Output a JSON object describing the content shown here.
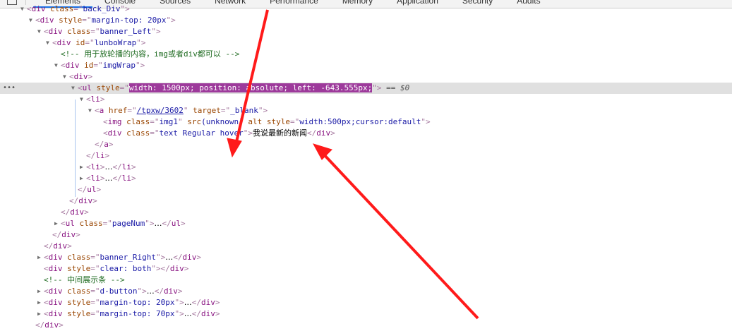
{
  "tabs": [
    "Elements",
    "Console",
    "Sources",
    "Network",
    "Performance",
    "Memory",
    "Application",
    "Security",
    "Audits"
  ],
  "active_tab": 0,
  "selected_row": 7,
  "selected_dots": "•••",
  "lines": [
    {
      "level": 0,
      "toggle": "open",
      "parts": [
        [
          "p",
          "<"
        ],
        [
          "t",
          "div"
        ],
        [
          "a",
          " class"
        ],
        [
          "p",
          "=\""
        ],
        [
          "v",
          "back_Div"
        ],
        [
          "p",
          "\">"
        ]
      ]
    },
    {
      "level": 1,
      "toggle": "open",
      "parts": [
        [
          "p",
          "<"
        ],
        [
          "t",
          "div"
        ],
        [
          "a",
          " style"
        ],
        [
          "p",
          "=\""
        ],
        [
          "v",
          "margin-top: 20px"
        ],
        [
          "p",
          "\">"
        ]
      ]
    },
    {
      "level": 2,
      "toggle": "open",
      "parts": [
        [
          "p",
          "<"
        ],
        [
          "t",
          "div"
        ],
        [
          "a",
          " class"
        ],
        [
          "p",
          "=\""
        ],
        [
          "v",
          "banner_Left"
        ],
        [
          "p",
          "\">"
        ]
      ]
    },
    {
      "level": 3,
      "toggle": "open",
      "parts": [
        [
          "p",
          "<"
        ],
        [
          "t",
          "div"
        ],
        [
          "a",
          " id"
        ],
        [
          "p",
          "=\""
        ],
        [
          "v",
          "lunboWrap"
        ],
        [
          "p",
          "\">"
        ]
      ]
    },
    {
      "level": 4,
      "toggle": "none",
      "parts": [
        [
          "c",
          "<!-- 用于放轮播的内容，img或者div都可以 -->"
        ]
      ]
    },
    {
      "level": 4,
      "toggle": "open",
      "parts": [
        [
          "p",
          "<"
        ],
        [
          "t",
          "div"
        ],
        [
          "a",
          " id"
        ],
        [
          "p",
          "=\""
        ],
        [
          "v",
          "imgWrap"
        ],
        [
          "p",
          "\">"
        ]
      ]
    },
    {
      "level": 5,
      "toggle": "open",
      "parts": [
        [
          "p",
          "<"
        ],
        [
          "t",
          "div"
        ],
        [
          "p",
          ">"
        ]
      ]
    },
    {
      "level": 6,
      "toggle": "open",
      "parts": [
        [
          "p",
          "<"
        ],
        [
          "t",
          "ul"
        ],
        [
          "a",
          " style"
        ],
        [
          "p",
          "=\""
        ],
        [
          "s",
          "width: 1500px; position: absolute; left: -643.555px;"
        ],
        [
          "p",
          "\">"
        ],
        [
          "m",
          " == $0"
        ]
      ]
    },
    {
      "level": 7,
      "toggle": "open",
      "parts": [
        [
          "p",
          "<"
        ],
        [
          "t",
          "li"
        ],
        [
          "p",
          ">"
        ]
      ]
    },
    {
      "level": 8,
      "toggle": "open",
      "parts": [
        [
          "p",
          "<"
        ],
        [
          "t",
          "a"
        ],
        [
          "a",
          " href"
        ],
        [
          "p",
          "=\""
        ],
        [
          "l",
          "/tpxw/3602"
        ],
        [
          "p",
          "\""
        ],
        [
          "a",
          " target"
        ],
        [
          "p",
          "=\""
        ],
        [
          "v",
          "_blank"
        ],
        [
          "p",
          "\">"
        ]
      ]
    },
    {
      "level": 9,
      "toggle": "none",
      "parts": [
        [
          "p",
          "<"
        ],
        [
          "t",
          "img"
        ],
        [
          "a",
          " class"
        ],
        [
          "p",
          "=\""
        ],
        [
          "v",
          "img1"
        ],
        [
          "p",
          "\""
        ],
        [
          "a",
          " src"
        ],
        [
          "v",
          "(unknown)"
        ],
        [
          "a",
          " alt style"
        ],
        [
          "p",
          "=\""
        ],
        [
          "v",
          "width:500px;cursor:default"
        ],
        [
          "p",
          "\">"
        ]
      ]
    },
    {
      "level": 9,
      "toggle": "none",
      "parts": [
        [
          "p",
          "<"
        ],
        [
          "t",
          "div"
        ],
        [
          "a",
          " class"
        ],
        [
          "p",
          "=\""
        ],
        [
          "v",
          "text Regular hover"
        ],
        [
          "p",
          "\">"
        ],
        [
          "x",
          "我说最新的新闻"
        ],
        [
          "p",
          "</"
        ],
        [
          "t",
          "div"
        ],
        [
          "p",
          ">"
        ]
      ]
    },
    {
      "level": 8,
      "toggle": "none",
      "parts": [
        [
          "p",
          "</"
        ],
        [
          "t",
          "a"
        ],
        [
          "p",
          ">"
        ]
      ]
    },
    {
      "level": 7,
      "toggle": "none",
      "parts": [
        [
          "p",
          "</"
        ],
        [
          "t",
          "li"
        ],
        [
          "p",
          ">"
        ]
      ]
    },
    {
      "level": 7,
      "toggle": "closed",
      "parts": [
        [
          "p",
          "<"
        ],
        [
          "t",
          "li"
        ],
        [
          "p",
          ">"
        ],
        [
          "x",
          "…"
        ],
        [
          "p",
          "</"
        ],
        [
          "t",
          "li"
        ],
        [
          "p",
          ">"
        ]
      ]
    },
    {
      "level": 7,
      "toggle": "closed",
      "parts": [
        [
          "p",
          "<"
        ],
        [
          "t",
          "li"
        ],
        [
          "p",
          ">"
        ],
        [
          "x",
          "…"
        ],
        [
          "p",
          "</"
        ],
        [
          "t",
          "li"
        ],
        [
          "p",
          ">"
        ]
      ]
    },
    {
      "level": 6,
      "toggle": "none",
      "parts": [
        [
          "p",
          "</"
        ],
        [
          "t",
          "ul"
        ],
        [
          "p",
          ">"
        ]
      ]
    },
    {
      "level": 5,
      "toggle": "none",
      "parts": [
        [
          "p",
          "</"
        ],
        [
          "t",
          "div"
        ],
        [
          "p",
          ">"
        ]
      ]
    },
    {
      "level": 4,
      "toggle": "none",
      "parts": [
        [
          "p",
          "</"
        ],
        [
          "t",
          "div"
        ],
        [
          "p",
          ">"
        ]
      ]
    },
    {
      "level": 4,
      "toggle": "closed",
      "parts": [
        [
          "p",
          "<"
        ],
        [
          "t",
          "ul"
        ],
        [
          "a",
          " class"
        ],
        [
          "p",
          "=\""
        ],
        [
          "v",
          "pageNum"
        ],
        [
          "p",
          "\">"
        ],
        [
          "x",
          "…"
        ],
        [
          "p",
          "</"
        ],
        [
          "t",
          "ul"
        ],
        [
          "p",
          ">"
        ]
      ]
    },
    {
      "level": 3,
      "toggle": "none",
      "parts": [
        [
          "p",
          "</"
        ],
        [
          "t",
          "div"
        ],
        [
          "p",
          ">"
        ]
      ]
    },
    {
      "level": 2,
      "toggle": "none",
      "parts": [
        [
          "p",
          "</"
        ],
        [
          "t",
          "div"
        ],
        [
          "p",
          ">"
        ]
      ]
    },
    {
      "level": 2,
      "toggle": "closed",
      "parts": [
        [
          "p",
          "<"
        ],
        [
          "t",
          "div"
        ],
        [
          "a",
          " class"
        ],
        [
          "p",
          "=\""
        ],
        [
          "v",
          "banner_Right"
        ],
        [
          "p",
          "\">"
        ],
        [
          "x",
          "…"
        ],
        [
          "p",
          "</"
        ],
        [
          "t",
          "div"
        ],
        [
          "p",
          ">"
        ]
      ]
    },
    {
      "level": 2,
      "toggle": "none",
      "parts": [
        [
          "p",
          "<"
        ],
        [
          "t",
          "div"
        ],
        [
          "a",
          " style"
        ],
        [
          "p",
          "=\""
        ],
        [
          "v",
          "clear: both"
        ],
        [
          "p",
          "\"></"
        ],
        [
          "t",
          "div"
        ],
        [
          "p",
          ">"
        ]
      ]
    },
    {
      "level": 2,
      "toggle": "none",
      "parts": [
        [
          "c",
          "<!-- 中间展示条 -->"
        ]
      ]
    },
    {
      "level": 2,
      "toggle": "closed",
      "parts": [
        [
          "p",
          "<"
        ],
        [
          "t",
          "div"
        ],
        [
          "a",
          " class"
        ],
        [
          "p",
          "=\""
        ],
        [
          "v",
          "d-button"
        ],
        [
          "p",
          "\">"
        ],
        [
          "x",
          "…"
        ],
        [
          "p",
          "</"
        ],
        [
          "t",
          "div"
        ],
        [
          "p",
          ">"
        ]
      ]
    },
    {
      "level": 2,
      "toggle": "closed",
      "parts": [
        [
          "p",
          "<"
        ],
        [
          "t",
          "div"
        ],
        [
          "a",
          " style"
        ],
        [
          "p",
          "=\""
        ],
        [
          "v",
          "margin-top: 20px"
        ],
        [
          "p",
          "\">"
        ],
        [
          "x",
          "…"
        ],
        [
          "p",
          "</"
        ],
        [
          "t",
          "div"
        ],
        [
          "p",
          ">"
        ]
      ]
    },
    {
      "level": 2,
      "toggle": "closed",
      "parts": [
        [
          "p",
          "<"
        ],
        [
          "t",
          "div"
        ],
        [
          "a",
          " style"
        ],
        [
          "p",
          "=\""
        ],
        [
          "v",
          "margin-top: 70px"
        ],
        [
          "p",
          "\">"
        ],
        [
          "x",
          "…"
        ],
        [
          "p",
          "</"
        ],
        [
          "t",
          "div"
        ],
        [
          "p",
          ">"
        ]
      ]
    },
    {
      "level": 1,
      "toggle": "none",
      "parts": [
        [
          "p",
          "</"
        ],
        [
          "t",
          "div"
        ],
        [
          "p",
          ">"
        ]
      ]
    }
  ],
  "annotation_color": "#ff1a1a"
}
